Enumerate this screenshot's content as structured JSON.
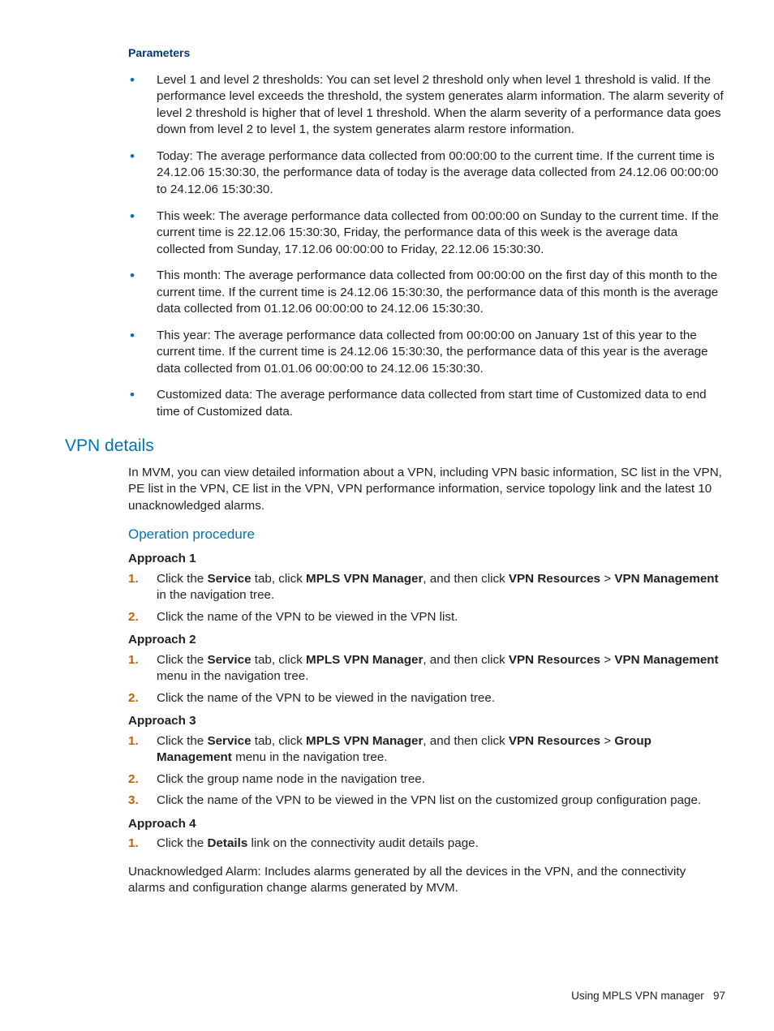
{
  "parameters": {
    "heading": "Parameters",
    "items": [
      "Level 1 and level 2 thresholds: You can set level 2 threshold only when level 1 threshold is valid. If the performance level exceeds the threshold, the system generates alarm information. The alarm severity of level 2 threshold is higher that of level 1 threshold. When the alarm severity of a performance data goes down from level 2 to level 1, the system generates alarm restore information.",
      "Today: The average performance data collected from 00:00:00 to the current time. If the current time is 24.12.06 15:30:30, the performance data of today is the average data collected from 24.12.06 00:00:00 to 24.12.06 15:30:30.",
      "This week: The average performance data collected from 00:00:00 on Sunday to the current time. If the current time is 22.12.06 15:30:30, Friday, the performance data of this week is the average data collected from Sunday, 17.12.06 00:00:00 to Friday, 22.12.06 15:30:30.",
      "This month: The average performance data collected from 00:00:00 on the first day of this month to the current time. If the current time is 24.12.06 15:30:30, the performance data of this month is the average data collected from 01.12.06 00:00:00 to 24.12.06 15:30:30.",
      "This year: The average performance data collected from 00:00:00 on January 1st of this year to the current time. If the current time is 24.12.06 15:30:30, the performance data of this year is the average data collected from 01.01.06 00:00:00 to 24.12.06 15:30:30.",
      "Customized data: The average performance data collected from start time of Customized data to end time of Customized data."
    ]
  },
  "vpn": {
    "heading": "VPN details",
    "intro": "In MVM, you can view detailed information about a VPN, including VPN basic information, SC list in the VPN, PE list in the VPN, CE list in the VPN, VPN performance information, service topology link and the latest 10 unacknowledged alarms.",
    "opHeading": "Operation procedure",
    "a1": {
      "head": "Approach 1",
      "s1a": "Click the ",
      "s1b": "Service",
      "s1c": " tab, click ",
      "s1d": "MPLS VPN Manager",
      "s1e": ", and then click ",
      "s1f": "VPN Resources",
      "s1g": " > ",
      "s1h": "VPN Management",
      "s1i": " in the navigation tree.",
      "s2": "Click the name of the VPN to be viewed in the VPN list."
    },
    "a2": {
      "head": "Approach 2",
      "s1a": "Click the ",
      "s1b": "Service",
      "s1c": " tab, click ",
      "s1d": "MPLS VPN Manager",
      "s1e": ", and then click ",
      "s1f": "VPN Resources",
      "s1g": " > ",
      "s1h": "VPN Management",
      "s1i": " menu in the navigation tree.",
      "s2": "Click the name of the VPN to be viewed in the navigation tree."
    },
    "a3": {
      "head": "Approach 3",
      "s1a": "Click the ",
      "s1b": "Service",
      "s1c": " tab, click ",
      "s1d": "MPLS VPN Manager",
      "s1e": ", and then click ",
      "s1f": "VPN Resources",
      "s1g": " > ",
      "s1h": "Group Management",
      "s1i": " menu in the navigation tree.",
      "s2": "Click the group name node in the navigation tree.",
      "s3": "Click the name of the VPN to be viewed in the VPN list on the customized group configuration page."
    },
    "a4": {
      "head": "Approach 4",
      "s1a": "Click the ",
      "s1b": "Details",
      "s1c": " link on the connectivity audit details page."
    },
    "trailer": "Unacknowledged Alarm: Includes alarms generated by all the devices in the VPN, and the connectivity alarms and configuration change alarms generated by MVM."
  },
  "footer": {
    "text": "Using MPLS VPN manager",
    "page": "97"
  }
}
